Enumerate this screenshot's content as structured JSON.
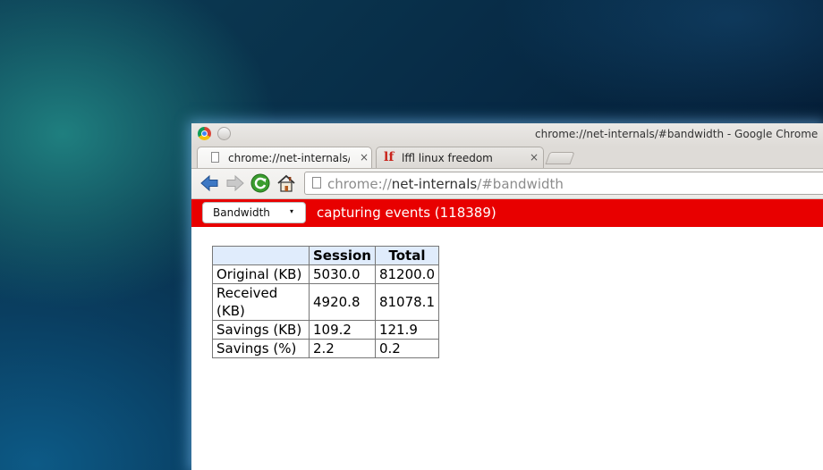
{
  "window": {
    "title": "chrome://net-internals/#bandwidth - Google Chrome"
  },
  "tabs": [
    {
      "label": "chrome://net-internals/",
      "close": "×",
      "active": true
    },
    {
      "label": "lffl linux freedom",
      "icon_text": "lf",
      "close": "×",
      "active": false
    }
  ],
  "toolbar": {
    "url_scheme": "chrome://",
    "url_host": "net-internals",
    "url_path": "/#bandwidth"
  },
  "statusbar": {
    "view_selected": "Bandwidth",
    "view_arrow": "▾",
    "status_text": "capturing events (118389)",
    "color": "#e80000"
  },
  "bandwidth_table": {
    "headers": [
      "",
      "Session",
      "Total"
    ],
    "rows": [
      [
        "Original (KB)",
        "5030.0",
        "81200.0"
      ],
      [
        "Received (KB)",
        "4920.8",
        "81078.1"
      ],
      [
        "Savings (KB)",
        "109.2",
        "121.9"
      ],
      [
        "Savings (%)",
        "2.2",
        "0.2"
      ]
    ]
  },
  "icons": [
    "chrome-logo-icon",
    "window-menu-icon",
    "page-icon",
    "back-arrow-icon",
    "forward-arrow-icon",
    "reload-icon",
    "home-icon",
    "new-tab-icon"
  ]
}
